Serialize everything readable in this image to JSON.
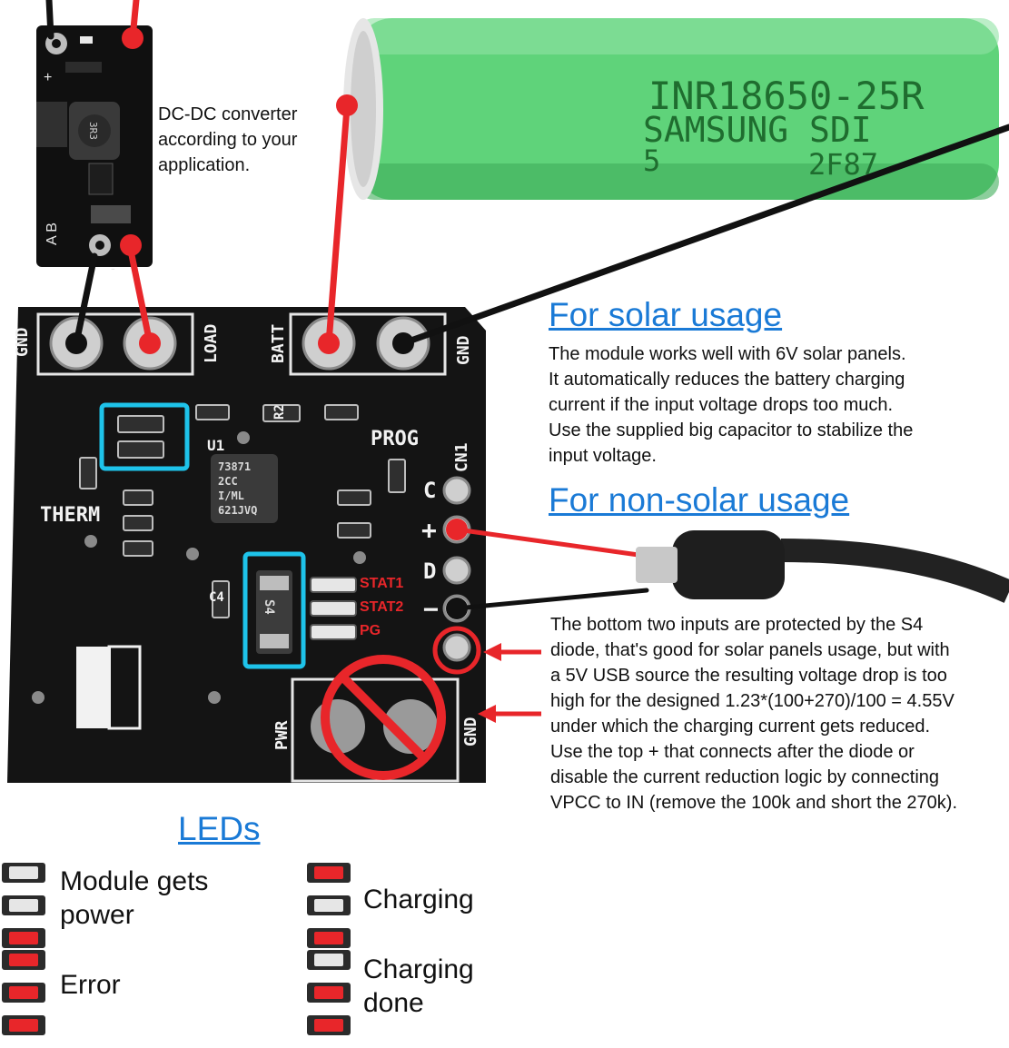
{
  "converter_note": "DC-DC converter\naccording to your\napplication.",
  "battery": {
    "line1": "INR18650-25R",
    "line2": "SAMSUNG SDI",
    "line3a": "5",
    "line3b": "2F87"
  },
  "pcb": {
    "gnd_left": "GND",
    "load": "LOAD",
    "batt": "BATT",
    "gnd_right": "GND",
    "prog": "PROG",
    "cn1": "CN1",
    "therm": "THERM",
    "u1": "U1",
    "chip_lines": [
      "73871",
      "2CC",
      "I/ML",
      "621JVQ"
    ],
    "c4": "C4",
    "s4": "S4",
    "pwr": "PWR",
    "gnd_bottom": "GND",
    "pin_c": "C",
    "pin_plus": "+",
    "pin_d": "D",
    "pin_minus": "−",
    "r2": "R2",
    "stat1": "STAT1",
    "stat2": "STAT2",
    "pg": "PG"
  },
  "solar": {
    "heading": "For solar usage",
    "text": "The module works well with 6V solar panels.\nIt automatically reduces the battery charging\ncurrent if the input voltage drops too much.\nUse the supplied big capacitor to stabilize the\ninput voltage."
  },
  "nonsolar": {
    "heading": "For non-solar usage",
    "text": "The bottom two inputs are protected by the S4\ndiode, that's good for solar panels usage, but with\na 5V USB source the resulting voltage drop is too\nhigh for the designed 1.23*(100+270)/100 = 4.55V\nunder which the charging current gets reduced.\nUse the top + that connects after the diode or\ndisable the current reduction logic by connecting\nVPCC to IN (remove the 100k and short the 270k)."
  },
  "leds": {
    "heading": "LEDs",
    "states": [
      {
        "label": "Module gets\npower",
        "lit": [
          false,
          false,
          true
        ]
      },
      {
        "label": "Charging",
        "lit": [
          true,
          false,
          true
        ]
      },
      {
        "label": "Error",
        "lit": [
          true,
          true,
          true
        ]
      },
      {
        "label": "Charging\ndone",
        "lit": [
          false,
          true,
          true
        ]
      }
    ]
  },
  "colors": {
    "wire_red": "#e8262a",
    "wire_black": "#111111",
    "highlight": "#1ec3ea",
    "link_blue": "#1a7ad6",
    "battery_green": "#5fd37a",
    "pcb": "#141414"
  }
}
